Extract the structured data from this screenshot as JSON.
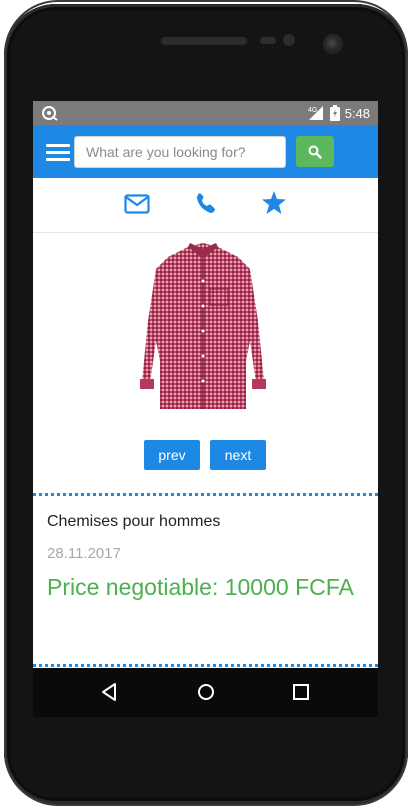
{
  "status_bar": {
    "time": "5:48",
    "network": "4G",
    "icons": [
      "notification-icon",
      "signal-icon",
      "battery-icon"
    ]
  },
  "header": {
    "search_placeholder": "What are you looking for?",
    "search_value": "",
    "accent_color": "#1e88e5",
    "search_button_color": "#5cb85c"
  },
  "contact": {
    "icons": [
      "email-icon",
      "phone-icon",
      "star-icon"
    ]
  },
  "product": {
    "image": "shirt-image",
    "prev_label": "prev",
    "next_label": "next",
    "title": "Chemises pour hommes",
    "date": "28.11.2017",
    "price": "Price negotiable: 10000 FCFA",
    "price_color": "#4caf50"
  },
  "nav": {
    "icons": [
      "back-icon",
      "home-icon",
      "recents-icon"
    ]
  }
}
